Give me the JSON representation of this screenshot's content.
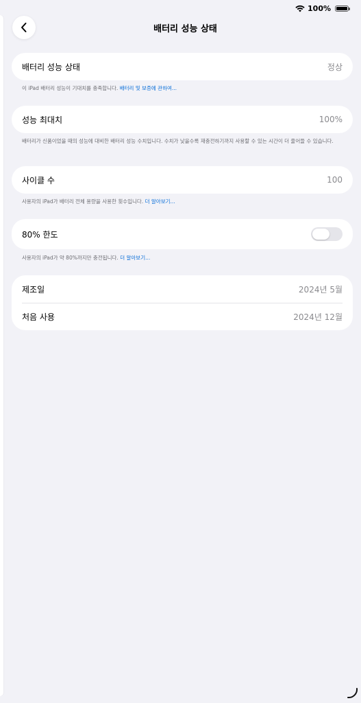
{
  "status_bar": {
    "battery_percent": "100%",
    "wifi_icon": "wifi-icon",
    "battery_icon": "battery-icon"
  },
  "nav": {
    "title": "배터리 성능 상태",
    "back_icon": "chevron-left-icon"
  },
  "battery_health": {
    "label": "배터리 성능 상태",
    "value": "정상",
    "note": "이 iPad 배터리 성능이 기대치를 충족합니다.",
    "note_link": "배터리 및 보증에 관하여..."
  },
  "max_capacity": {
    "label": "성능 최대치",
    "value": "100%",
    "note": "배터리가 신품이었을 때의 성능에 대비한 배터리 성능 수치입니다. 수치가 낮을수록 재충전하기까지 사용할 수 있는 시간이 더 줄어들 수 있습니다."
  },
  "cycle_count": {
    "label": "사이클 수",
    "value": "100",
    "note": "사용자의 iPad가 배터리 전체 용량을 사용한 횟수입니다.",
    "note_link": "더 알아보기..."
  },
  "limit_80": {
    "label": "80% 한도",
    "toggle_on": false,
    "note": "사용자의 iPad가 약 80%까지만 충전됩니다.",
    "note_link": "더 알아보기..."
  },
  "dates": {
    "manufacture_label": "제조일",
    "manufacture_value": "2024년 5월",
    "first_use_label": "처음 사용",
    "first_use_value": "2024년 12월"
  },
  "colors": {
    "background": "#f2f2f7",
    "card": "#ffffff",
    "link": "#0a6fd8",
    "secondary_text": "#8a8a8e"
  }
}
